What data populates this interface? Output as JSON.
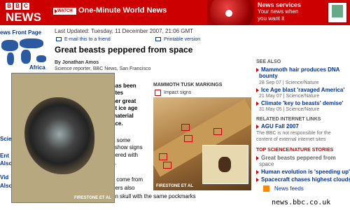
{
  "header": {
    "logo_letters": [
      "B",
      "B",
      "C"
    ],
    "logo_text": "NEWS",
    "watch_label": "WATCH",
    "title": "One-Minute World News",
    "services_title": "News services",
    "services_line1": "Your news when",
    "services_line2": "you want it",
    "brand_color": "#cc0000"
  },
  "leftnav": {
    "home": "ews Front Page",
    "region": "Africa",
    "frag1": "Scie",
    "frag2": "Ent",
    "frag3": "Also",
    "frag4": "Vid",
    "frag5": "Also"
  },
  "article": {
    "updated": "Last Updated: Tuesday, 11 December 2007, 21:06 GMT",
    "email_link": "E-mail this to a friend",
    "print_link": "Printable version",
    "headline": "Great beasts peppered from space",
    "author": "By Jonathan Amos",
    "role": "Science reporter, BBC News, San Francisco",
    "lines": [
      {
        "text": "has been",
        "bold": true
      },
      {
        "text": "stes",
        "bold": true
      },
      {
        "text": "her great",
        "bold": true
      },
      {
        "text": "st ice age",
        "bold": true
      },
      {
        "text": "material",
        "bold": true
      },
      {
        "text": "ace.",
        "bold": true
      },
      {
        "text": "o some",
        "bold": false
      },
      {
        "text": "l show signs",
        "bold": false
      },
      {
        "text": "pered with",
        "bold": false
      },
      {
        "text": "s.",
        "bold": false
      },
      {
        "text": "s come from",
        "bold": false
      },
      {
        "text": "hers also",
        "bold": false
      },
      {
        "text": "on skull with the same pockmarks",
        "bold": false
      }
    ],
    "photo_credit": "FIRESTONE ET AL",
    "tusk_title": "MAMMOTH TUSK MARKINGS",
    "impact_label": "Impact signs",
    "tusk_credit": "FIRESTONE ET AL"
  },
  "sidebar": {
    "see_also": "SEE ALSO",
    "links": [
      {
        "title": "Mammoth hair produces DNA",
        "title2": "bounty",
        "date": "28 Sep 07 | Science/Nature"
      },
      {
        "title": "Ice Age blast 'ravaged America'",
        "date": "21 May 07 | Science/Nature"
      },
      {
        "title": "Climate 'key to beasts' demise'",
        "date": "31 May 05 | Science/Nature"
      }
    ],
    "related_internet": "RELATED INTERNET LINKS",
    "agu": "AGU Fall 2007",
    "disclaimer1": "The BBC is not responsible for the",
    "disclaimer2": "content of external internet sites",
    "top_stories": "TOP SCIENCE/NATURE STORIES",
    "stories": [
      "Great beasts peppered from",
      "space",
      "Human evolution is 'speeding up'",
      "Spacecraft chases highest clouds"
    ],
    "feeds": "News feeds",
    "domain": "news.bbc.co.uk"
  }
}
